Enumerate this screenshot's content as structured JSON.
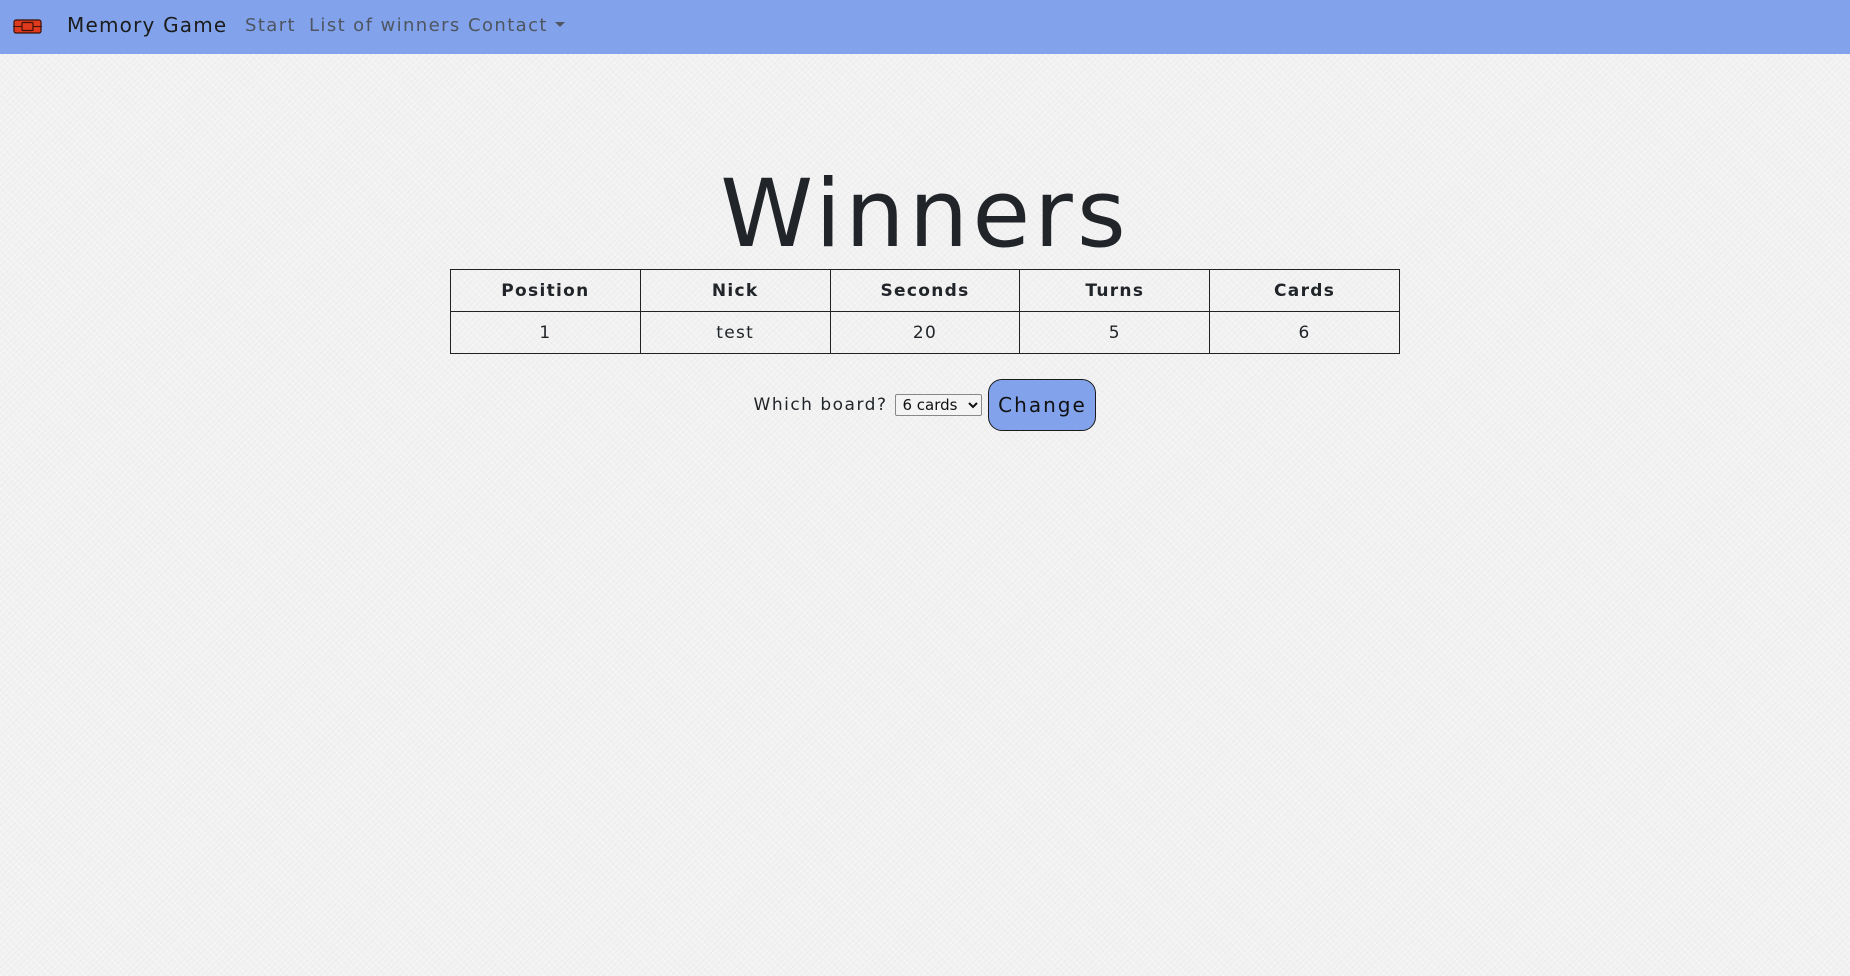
{
  "navbar": {
    "brand": "Memory Game",
    "logo_icon": "card-logo-icon",
    "links": {
      "start": "Start",
      "winners": "List of winners",
      "contact": "Contact"
    }
  },
  "main": {
    "title": "Winners",
    "table": {
      "headers": [
        "Position",
        "Nick",
        "Seconds",
        "Turns",
        "Cards"
      ],
      "rows": [
        [
          "1",
          "test",
          "20",
          "5",
          "6"
        ]
      ]
    },
    "board": {
      "label": "Which board?",
      "selected": "6 cards",
      "button": "Change"
    }
  },
  "colors": {
    "navbar": "#82a3eb",
    "button": "#82a3eb",
    "logo": "#e03a1e"
  }
}
